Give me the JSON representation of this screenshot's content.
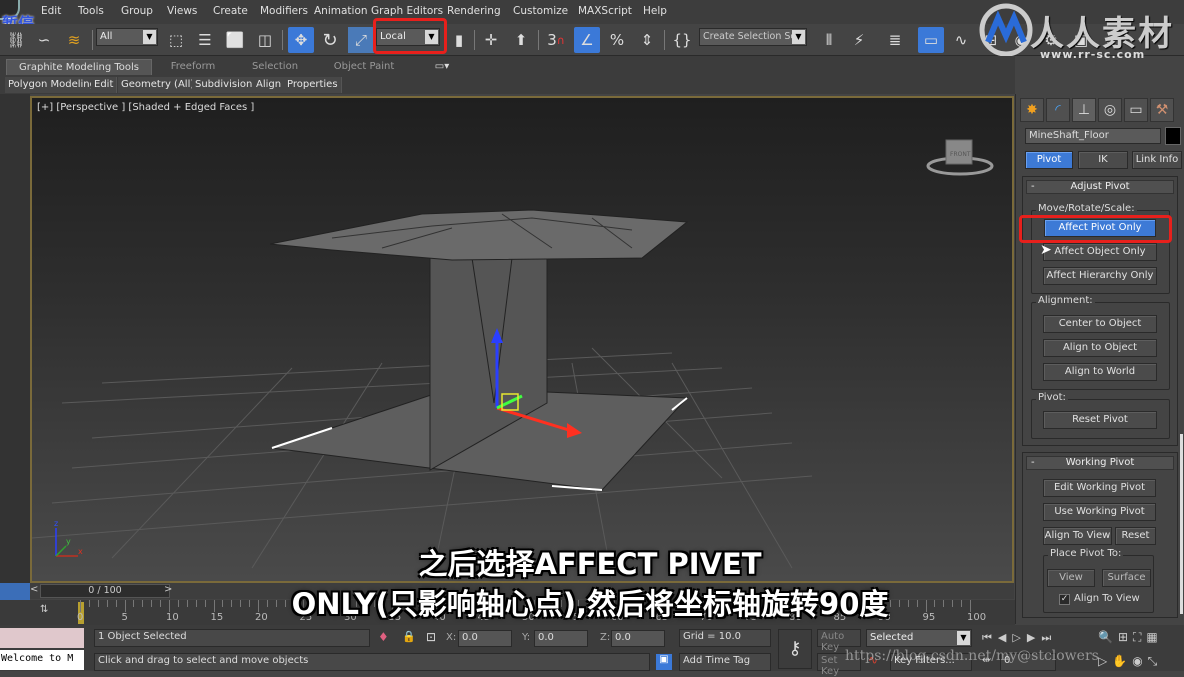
{
  "menu": {
    "items": [
      "Edit",
      "Tools",
      "Group",
      "Views",
      "Create",
      "Modifiers",
      "Animation",
      "Graph Editors",
      "Rendering",
      "Customize",
      "MAXScript",
      "Help"
    ],
    "pause_label": "暂停"
  },
  "toolbar": {
    "selection_filter": "All",
    "coord_system": "Local",
    "snap_label": "3",
    "named_selection_placeholder": "Create Selection Set",
    "icons": [
      "select-and-link-icon",
      "unlink-icon",
      "bind-to-space-warp-icon",
      "select-object-icon",
      "select-by-name-icon",
      "rectangular-selection-icon",
      "window-crossing-icon",
      "select-and-move-icon",
      "select-and-rotate-icon",
      "select-and-scale-icon",
      "use-pivot-center-icon",
      "select-manipulate-icon",
      "keyboard-shortcut-icon",
      "snaps-toggle-icon",
      "angle-snap-icon",
      "percent-snap-icon",
      "spinner-snap-icon",
      "edit-named-selection-icon",
      "mirror-icon",
      "align-icon",
      "layer-manager-icon",
      "ribbon-toggle-icon",
      "curve-editor-icon",
      "schematic-view-icon",
      "material-editor-icon",
      "render-setup-icon",
      "rendered-frame-icon",
      "render-icon"
    ]
  },
  "ribbon": {
    "tabs": [
      "Graphite Modeling Tools",
      "Freeform",
      "Selection",
      "Object Paint"
    ],
    "active_tab": "Graphite Modeling Tools",
    "subtabs": [
      "Polygon Modeling",
      "Edit",
      "Geometry (All)",
      "Subdivision",
      "Align",
      "Properties"
    ]
  },
  "viewport": {
    "label": "[+] [Perspective ] [Shaded + Edged Faces ]",
    "viewcube_face": "FRONT",
    "axis_labels": {
      "x": "x",
      "y": "y",
      "z": "z"
    }
  },
  "command_panel": {
    "tabs": [
      "create-icon",
      "modify-icon",
      "hierarchy-icon",
      "motion-icon",
      "display-icon",
      "utilities-icon"
    ],
    "object_name": "MineShaft_Floor",
    "object_color": "#000000",
    "subtabs": [
      "Pivot",
      "IK",
      "Link Info"
    ],
    "active_subtab": "Pivot",
    "adjust_pivot": {
      "title": "Adjust Pivot",
      "collapse": "-",
      "move_group": "Move/Rotate/Scale:",
      "buttons": [
        "Affect Pivot Only",
        "Affect Object Only",
        "Affect Hierarchy Only"
      ],
      "active_button": "Affect Pivot Only",
      "alignment_group": "Alignment:",
      "alignment_buttons": [
        "Center to Object",
        "Align to Object",
        "Align to World"
      ],
      "pivot_group": "Pivot:",
      "reset_pivot": "Reset Pivot"
    },
    "working_pivot": {
      "title": "Working Pivot",
      "collapse": "-",
      "edit": "Edit Working Pivot",
      "use": "Use Working Pivot",
      "align_to_view": "Align To View",
      "reset": "Reset",
      "place_group": "Place Pivot To:",
      "view": "View",
      "surface": "Surface",
      "align_checkbox": "Align To View",
      "align_checked": true
    }
  },
  "timeline": {
    "frame_readout": "0 / 100",
    "prev": "<",
    "next": ">",
    "ticks": [
      "0",
      "5",
      "10",
      "15",
      "20",
      "25",
      "30",
      "35",
      "40",
      "45",
      "50",
      "55",
      "60",
      "65",
      "70",
      "75",
      "80",
      "85",
      "90",
      "95",
      "100"
    ]
  },
  "status": {
    "maxscript_listener": "Welcome to M",
    "selection_info": "1 Object Selected",
    "prompt": "Click and drag to select and move objects",
    "x_label": "X:",
    "x": "0.0",
    "y_label": "Y:",
    "y": "0.0",
    "z_label": "Z:",
    "z": "0.0",
    "grid": "Grid = 10.0",
    "add_time_tag": "Add Time Tag",
    "auto_key": "Auto Key",
    "set_key": "Set Key",
    "key_mode": "Selected",
    "key_filters": "Key Filters...",
    "current_frame": "0"
  },
  "subtitle": {
    "line1": "之后选择AFFECT PIVET",
    "line2": "ONLY(只影响轴心点),然后将坐标轴旋转90度"
  },
  "watermark": {
    "brand": "人人素材",
    "url": "www.rr-sc.com",
    "blog_url": "https://blog.csdn.net/my@stclowers"
  },
  "colors": {
    "accent_blue": "#3b79d8",
    "highlight_red": "#e8201c",
    "viewport_border": "#7a6a3a"
  }
}
